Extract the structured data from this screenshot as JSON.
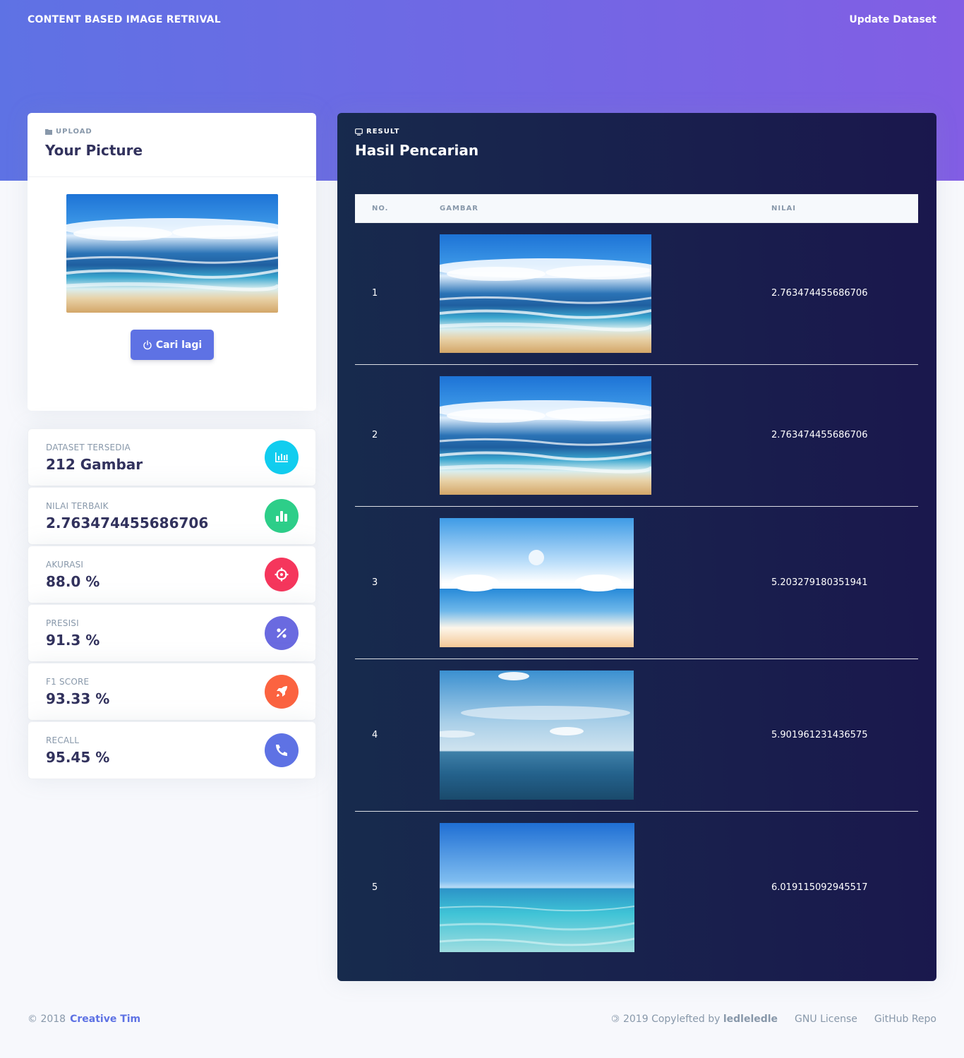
{
  "navbar": {
    "brand": "CONTENT BASED IMAGE RETRIVAL",
    "update_link": "Update Dataset"
  },
  "upload": {
    "overline": "UPLOAD",
    "title": "Your Picture",
    "icon": "folder-icon",
    "button_label": "Cari lagi",
    "button_icon": "power-icon"
  },
  "stats": [
    {
      "label": "DATASET TERSEDIA",
      "value": "212 Gambar",
      "icon": "chart-bar-icon",
      "color": "#11cdef"
    },
    {
      "label": "NILAI TERBAIK",
      "value": "2.763474455686706",
      "icon": "chart-icon",
      "color": "#2dce89"
    },
    {
      "label": "AKURASI",
      "value": "88.0 %",
      "icon": "target-icon",
      "color": "#f5365c"
    },
    {
      "label": "PRESISI",
      "value": "91.3 %",
      "icon": "percent-icon",
      "color": "#5e72e4"
    },
    {
      "label": "F1 SCORE",
      "value": "93.33 %",
      "icon": "rocket-icon",
      "color": "#fb6340"
    },
    {
      "label": "RECALL",
      "value": "95.45 %",
      "icon": "phone-icon",
      "color": "#5e72e4"
    }
  ],
  "result": {
    "overline": "RESULT",
    "title": "Hasil Pencarian",
    "icon": "monitor-icon",
    "columns": [
      "NO.",
      "GAMBAR",
      "NILAI"
    ],
    "rows": [
      {
        "no": "1",
        "nilai": "2.763474455686706"
      },
      {
        "no": "2",
        "nilai": "2.763474455686706"
      },
      {
        "no": "3",
        "nilai": "5.203279180351941"
      },
      {
        "no": "4",
        "nilai": "5.901961231436575"
      },
      {
        "no": "5",
        "nilai": "6.019115092945517"
      }
    ]
  },
  "footer": {
    "copyright": "© 2018",
    "company": "Creative Tim",
    "copyleft_prefix": "2019 Copylefted by",
    "copyleft_author": "ledleledle",
    "links": [
      "GNU License",
      "GitHub Repo"
    ]
  }
}
